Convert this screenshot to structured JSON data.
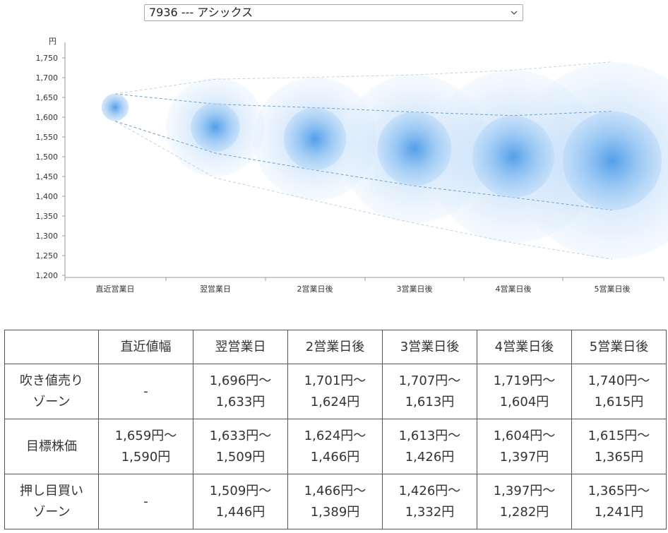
{
  "stock_select": {
    "selected": "7936 --- アシックス"
  },
  "chart_data": {
    "type": "scatter",
    "yunit": "円",
    "ylim": [
      1200,
      1750
    ],
    "yticks": [
      1200,
      1250,
      1300,
      1350,
      1400,
      1450,
      1500,
      1550,
      1600,
      1650,
      1700,
      1750
    ],
    "ytick_labels": [
      "1,200",
      "1,250",
      "1,300",
      "1,350",
      "1,400",
      "1,450",
      "1,500",
      "1,550",
      "1,600",
      "1,650",
      "1,700",
      "1,750"
    ],
    "categories": [
      "直近営業日",
      "翌営業日",
      "2営業日後",
      "3営業日後",
      "4営業日後",
      "5営業日後"
    ],
    "center": [
      1625,
      1575,
      1545,
      1520,
      1500,
      1490
    ],
    "target_upper": [
      1659,
      1633,
      1624,
      1613,
      1604,
      1615
    ],
    "target_lower": [
      1590,
      1509,
      1466,
      1426,
      1397,
      1365
    ],
    "outer_upper": [
      1659,
      1696,
      1701,
      1707,
      1719,
      1740
    ],
    "outer_lower": [
      1590,
      1446,
      1389,
      1332,
      1282,
      1241
    ],
    "colors": {
      "inner": "#4d9be8",
      "outer": "#cfe4fb",
      "line": "#6fa0cf",
      "outer_line": "#c4d4e4"
    },
    "grid": false
  },
  "table": {
    "headers": [
      "",
      "直近値幅",
      "翌営業日",
      "2営業日後",
      "3営業日後",
      "4営業日後",
      "5営業日後"
    ],
    "rows": [
      {
        "label": [
          "吹き値売り",
          "ゾーン"
        ],
        "cells": [
          [
            "-"
          ],
          [
            "1,696円〜",
            "1,633円"
          ],
          [
            "1,701円〜",
            "1,624円"
          ],
          [
            "1,707円〜",
            "1,613円"
          ],
          [
            "1,719円〜",
            "1,604円"
          ],
          [
            "1,740円〜",
            "1,615円"
          ]
        ]
      },
      {
        "label": [
          "目標株価"
        ],
        "cells": [
          [
            "1,659円〜",
            "1,590円"
          ],
          [
            "1,633円〜",
            "1,509円"
          ],
          [
            "1,624円〜",
            "1,466円"
          ],
          [
            "1,613円〜",
            "1,426円"
          ],
          [
            "1,604円〜",
            "1,397円"
          ],
          [
            "1,615円〜",
            "1,365円"
          ]
        ]
      },
      {
        "label": [
          "押し目買い",
          "ゾーン"
        ],
        "cells": [
          [
            "-"
          ],
          [
            "1,509円〜",
            "1,446円"
          ],
          [
            "1,466円〜",
            "1,389円"
          ],
          [
            "1,426円〜",
            "1,332円"
          ],
          [
            "1,397円〜",
            "1,282円"
          ],
          [
            "1,365円〜",
            "1,241円"
          ]
        ]
      }
    ]
  }
}
